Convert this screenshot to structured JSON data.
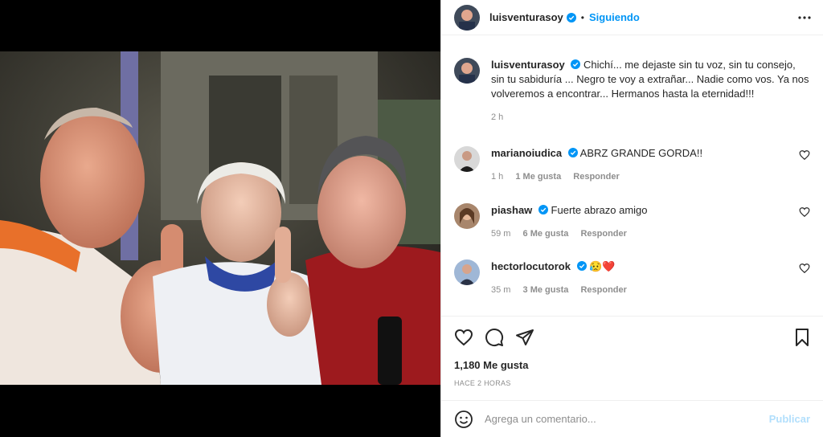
{
  "post": {
    "author": "luisventurasoy",
    "follow_status": "Siguiendo",
    "separator": "•",
    "caption": "Chichí... me dejaste sin tu voz, sin tu consejo, sin tu sabiduría ... Negro te voy a extrañar... Nadie como vos. Ya nos volveremos a encontrar... Hermanos hasta la eternidad!!!",
    "caption_time": "2 h",
    "likes": "1,180 Me gusta",
    "posted": "HACE 2 HORAS"
  },
  "comments": [
    {
      "user": "marianoiudica",
      "text": "ABRZ GRANDE GORDA!!",
      "time": "1 h",
      "likes": "1 Me gusta",
      "reply": "Responder"
    },
    {
      "user": "piashaw",
      "text": "Fuerte abrazo amigo",
      "time": "59 m",
      "likes": "6 Me gusta",
      "reply": "Responder"
    },
    {
      "user": "hectorlocutorok",
      "text": "😥❤️",
      "time": "35 m",
      "likes": "3 Me gusta",
      "reply": "Responder"
    }
  ],
  "composer": {
    "placeholder": "Agrega un comentario...",
    "submit": "Publicar"
  },
  "icons": {
    "verified": "verified-badge-icon",
    "more": "more-options-icon",
    "like": "heart-icon",
    "comment": "comment-icon",
    "share": "share-icon",
    "save": "bookmark-icon",
    "emoji": "emoji-icon"
  },
  "colors": {
    "accent": "#0095f6",
    "muted": "#8e8e8e",
    "submit_disabled": "#b2dffc",
    "heart_red": "#ed4956"
  }
}
